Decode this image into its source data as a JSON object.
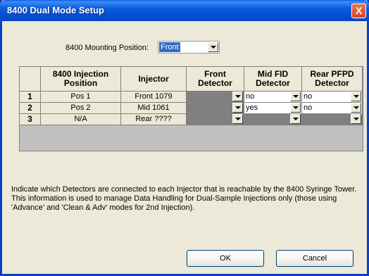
{
  "window": {
    "title": "8400 Dual Mode Setup",
    "close_glyph": "X"
  },
  "mounting": {
    "label": "8400 Mounting Position:",
    "value": "Front"
  },
  "table": {
    "headers": {
      "row_num": "",
      "injection_position": "8400 Injection Position",
      "injector": "Injector",
      "front_detector": "Front Detector",
      "mid_detector": "Mid FID Detector",
      "rear_detector": "Rear PFPD Detector"
    },
    "rows": [
      {
        "num": "1",
        "position": "Pos 1",
        "injector": "Front 1079",
        "mid": "no",
        "rear": "no"
      },
      {
        "num": "2",
        "position": "Pos 2",
        "injector": "Mid 1061",
        "mid": "yes",
        "rear": "no"
      },
      {
        "num": "3",
        "position": "N/A",
        "injector": "Rear ????",
        "mid": "",
        "rear": ""
      }
    ]
  },
  "info_text": "Indicate which Detectors are connected to each Injector that is reachable by the 8400 Syringe Tower.  This information is used to manage Data Handling for Dual-Sample Injections only (those using 'Advance' and 'Clean & Adv' modes for 2nd Injection).",
  "buttons": {
    "ok": "OK",
    "cancel": "Cancel"
  },
  "colors": {
    "title_bar": "#0b5bdc",
    "dialog_bg": "#ece9d8",
    "selection": "#316ac5",
    "disabled_cell": "#808080"
  }
}
